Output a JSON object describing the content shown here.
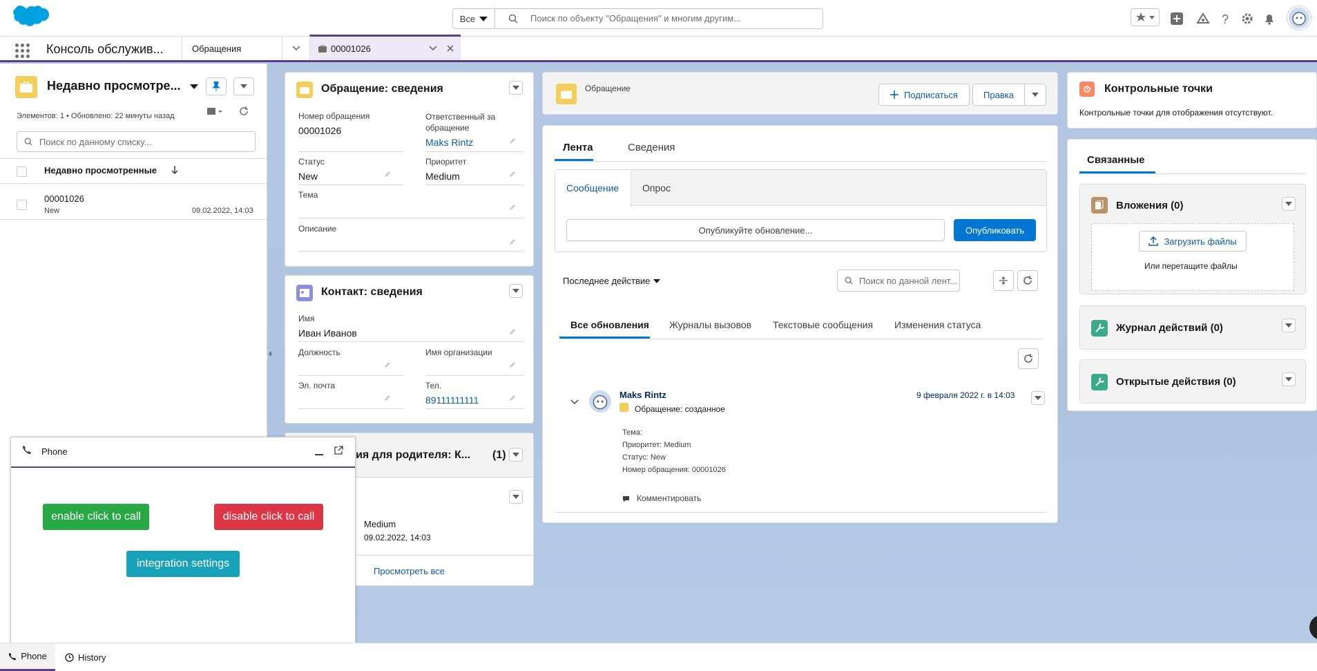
{
  "header": {
    "scope": "Все",
    "search_placeholder": "Поиск по объекту \"Обращения\" и многим другим..."
  },
  "nav": {
    "app_name": "Консоль обслужив...",
    "tab_object": "Обращения",
    "tab_record": "00001026"
  },
  "list": {
    "title": "Недавно просмотре...",
    "meta": "Элементов: 1 • Обновлено: 22 минуты назад",
    "search_placeholder": "Поиск по данному списку...",
    "column": "Недавно просмотренные",
    "rows": [
      {
        "number": "00001026",
        "status": "New",
        "date": "09.02.2022, 14:03"
      }
    ]
  },
  "case_details": {
    "title": "Обращение: сведения",
    "number_label": "Номер обращения",
    "number": "00001026",
    "owner_label": "Ответственный за обращение",
    "owner": "Maks Rintz",
    "status_label": "Статус",
    "status": "New",
    "priority_label": "Приоритет",
    "priority": "Medium",
    "subject_label": "Тема",
    "description_label": "Описание"
  },
  "contact": {
    "title": "Контакт: сведения",
    "name_label": "Имя",
    "name": "Иван Иванов",
    "position_label": "Должность",
    "org_label": "Имя организации",
    "email_label": "Эл. почта",
    "phone_label": "Тел.",
    "phone": "89111111111"
  },
  "parent_cases": {
    "title": "щения для родителя: К...",
    "count": "(1)",
    "priority": "Medium",
    "date": "09.02.2022, 14:03",
    "view_all": "Просмотреть все"
  },
  "record_header": {
    "object": "Обращение",
    "follow": "Подписаться",
    "edit": "Правка"
  },
  "feed": {
    "tab_feed": "Лента",
    "tab_details": "Сведения",
    "tab_message": "Сообщение",
    "tab_poll": "Опрос",
    "post_placeholder": "Опубликуйте обновление...",
    "publish": "Опубликовать",
    "sort": "Последнее действие",
    "search_placeholder": "Поиск по данной лент...",
    "filters": [
      "Все обновления",
      "Журналы вызовов",
      "Текстовые сообщения",
      "Изменения статуса"
    ],
    "post": {
      "author": "Maks Rintz",
      "date": "9 февраля 2022 г. в 14:03",
      "action": "Обращение: созданное",
      "lines": [
        "Тема:",
        "Приоритет: Medium",
        "Статус: New",
        "Номер обращения: 00001026"
      ],
      "comment": "Комментировать"
    }
  },
  "milestones": {
    "title": "Контрольные точки",
    "empty": "Контрольные точки для отображения отсутствуют."
  },
  "related": {
    "tab": "Связанные",
    "attachments": "Вложения (0)",
    "upload": "Загрузить файлы",
    "drop": "Или перетащите файлы",
    "activity_log": "Журнал действий (0)",
    "open_activities": "Открытые действия (0)"
  },
  "phone": {
    "title": "Phone",
    "enable": "enable click to call",
    "disable": "disable click to call",
    "settings": "integration settings"
  },
  "utility": {
    "phone": "Phone",
    "history": "History"
  },
  "colors": {
    "brand_blue": "#0176d3",
    "nav_accent": "#5a3f8f",
    "green": "#28a745",
    "red": "#dc3545",
    "teal": "#17a2b8"
  }
}
